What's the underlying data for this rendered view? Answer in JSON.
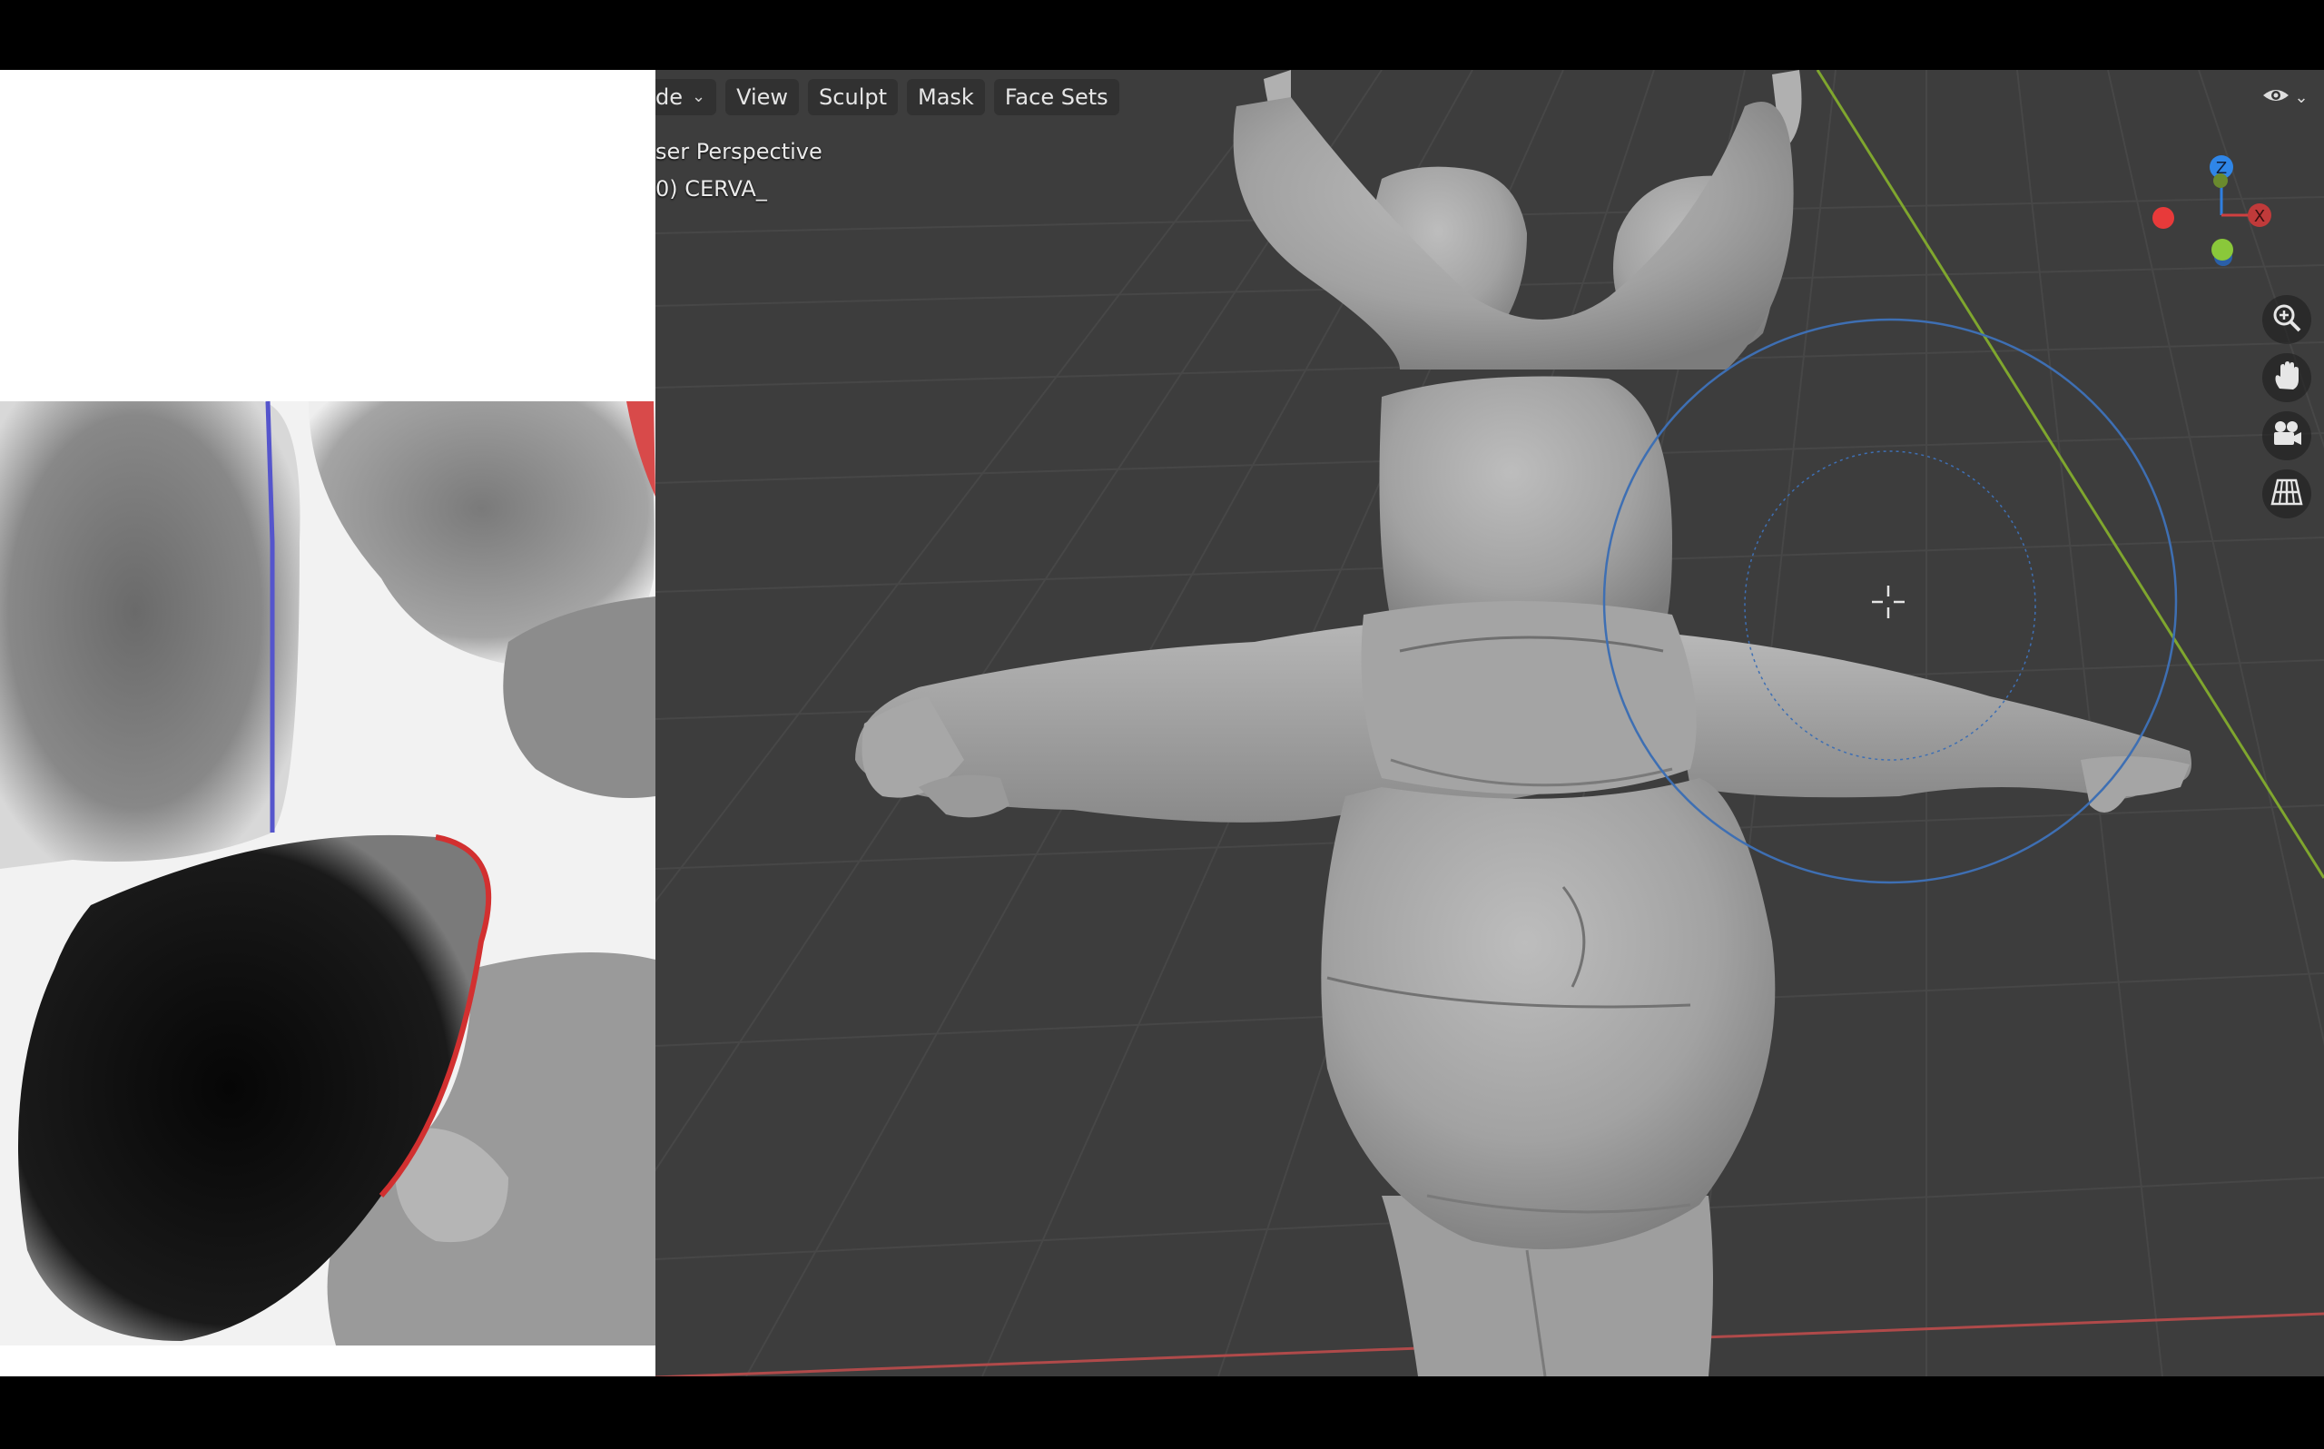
{
  "header": {
    "mode_label": "de",
    "menus": [
      "View",
      "Sculpt",
      "Mask",
      "Face Sets"
    ]
  },
  "viewport": {
    "perspective_label": "ser Perspective",
    "object_label": "0) CERVA_"
  },
  "gizmo": {
    "z_label": "Z",
    "x_label": "X"
  },
  "colors": {
    "viewport_bg": "#3d3d3d",
    "grid": "#4a4a4a",
    "axis_x": "#b04a4a",
    "axis_y": "#7fa62e",
    "brush": "#3e6fb3",
    "mesh": "#9c9c9c"
  },
  "icons": [
    "zoom-icon",
    "pan-hand-icon",
    "camera-icon",
    "grid-icon",
    "visibility-eye-icon",
    "chevron-down-icon"
  ]
}
